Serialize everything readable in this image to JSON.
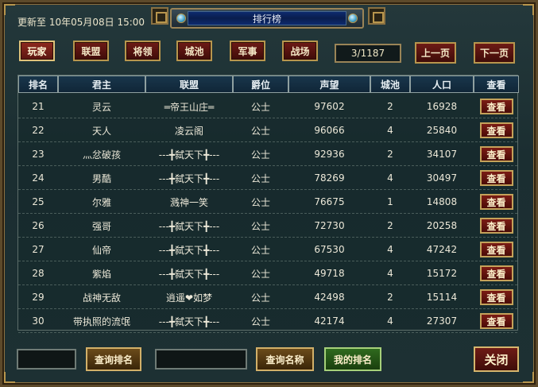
{
  "header": {
    "update_text": "更新至 10年05月08日 15:00",
    "title": "排行榜"
  },
  "categories": [
    {
      "label": "玩家",
      "active": true
    },
    {
      "label": "联盟",
      "active": false
    },
    {
      "label": "将领",
      "active": false
    },
    {
      "label": "城池",
      "active": false
    },
    {
      "label": "军事",
      "active": false
    },
    {
      "label": "战场",
      "active": false
    }
  ],
  "pagination": {
    "counter": "3/1187",
    "prev_label": "上一页",
    "next_label": "下一页"
  },
  "table": {
    "columns": [
      "排名",
      "君主",
      "联盟",
      "爵位",
      "声望",
      "城池",
      "人口",
      "查看"
    ],
    "view_label": "查看",
    "rows": [
      {
        "rank": "21",
        "lord": "灵云",
        "alliance": "═帝王山庄═",
        "title": "公士",
        "prestige": "97602",
        "cities": "2",
        "population": "16928"
      },
      {
        "rank": "22",
        "lord": "天人",
        "alliance": "凌云阁",
        "title": "公士",
        "prestige": "96066",
        "cities": "4",
        "population": "25840"
      },
      {
        "rank": "23",
        "lord": "灬忿破孩",
        "alliance": "---╋弑天下╋---",
        "title": "公士",
        "prestige": "92936",
        "cities": "2",
        "population": "34107"
      },
      {
        "rank": "24",
        "lord": "男酷",
        "alliance": "---╋弑天下╋---",
        "title": "公士",
        "prestige": "78269",
        "cities": "4",
        "population": "30497"
      },
      {
        "rank": "25",
        "lord": "尔雅",
        "alliance": "溅神一笑",
        "title": "公士",
        "prestige": "76675",
        "cities": "1",
        "population": "14808"
      },
      {
        "rank": "26",
        "lord": "强哥",
        "alliance": "---╋弑天下╋---",
        "title": "公士",
        "prestige": "72730",
        "cities": "2",
        "population": "20258"
      },
      {
        "rank": "27",
        "lord": "仙帝",
        "alliance": "---╋弑天下╋---",
        "title": "公士",
        "prestige": "67530",
        "cities": "4",
        "population": "47242"
      },
      {
        "rank": "28",
        "lord": "紫焰",
        "alliance": "---╋弑天下╋---",
        "title": "公士",
        "prestige": "49718",
        "cities": "4",
        "population": "15172"
      },
      {
        "rank": "29",
        "lord": "战神无敌",
        "alliance": "逍遥❤如梦",
        "title": "公士",
        "prestige": "42498",
        "cities": "2",
        "population": "15114"
      },
      {
        "rank": "30",
        "lord": "带执照的流氓",
        "alliance": "---╋弑天下╋---",
        "title": "公士",
        "prestige": "42174",
        "cities": "4",
        "population": "27307"
      }
    ]
  },
  "footer": {
    "rank_input_value": "",
    "search_rank_label": "查询排名",
    "name_input_value": "",
    "search_name_label": "查询名称",
    "my_rank_label": "我的排名",
    "close_label": "关闭"
  }
}
